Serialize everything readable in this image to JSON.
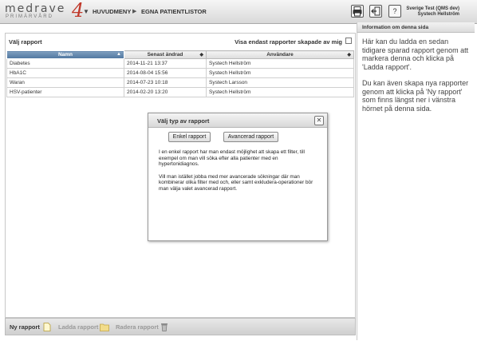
{
  "header": {
    "logo_text": "medrave",
    "logo_sub": "PRIMÄRVÅRD",
    "logo_number": "4",
    "menu_arrow": "▼",
    "nav_home": "HUVUDMENY",
    "nav_sep": "▶",
    "nav_current": "EGNA PATIENTLISTOR",
    "user_line1": "Sverige Test (QMS dev)",
    "user_line2": "Systech Hellström"
  },
  "main": {
    "title": "Välj rapport",
    "filter_label": "Visa endast rapporter skapade av mig",
    "columns": [
      "Namn",
      "Senast ändrad",
      "Användare"
    ],
    "rows": [
      {
        "name": "Diabetes",
        "changed": "2014-11-21 13:37",
        "user": "Systech Hellström"
      },
      {
        "name": "HbA1C",
        "changed": "2014-08-04 15:56",
        "user": "Systech Hellström"
      },
      {
        "name": "Waran",
        "changed": "2014-07-23 10:18",
        "user": "Systech Larsson"
      },
      {
        "name": "HSV-patienter",
        "changed": "2014-02-20 13:20",
        "user": "Systech Hellström"
      }
    ]
  },
  "footer": {
    "new_label": "Ny rapport",
    "load_label": "Ladda rapport",
    "delete_label": "Radera rapport"
  },
  "info": {
    "title": "Information om denna sida",
    "para1": "Här kan du ladda en sedan tidigare sparad rapport genom att markera denna och klicka på 'Ladda rapport'.",
    "para2": "Du kan även skapa nya rapporter genom att klicka på 'Ny rapport' som finns längst ner i vänstra hörnet på denna sida."
  },
  "modal": {
    "title": "Välj typ av rapport",
    "btn_simple": "Enkel rapport",
    "btn_advanced": "Avancerad rapport",
    "para1": "I en enkel rapport har man endast möjlighet att skapa ett filter, till exempel om man vill söka efter alla patienter med en hypertonidiagnos.",
    "para2": "Vill man istället jobba med mer avancerade sökningar där man kombinerar olika filter med och, eller samt exkludera-operationer bör man välja valet avancerad rapport."
  },
  "colors": {
    "header_accent": "#4f76a0",
    "logo_red": "#c0392b"
  }
}
